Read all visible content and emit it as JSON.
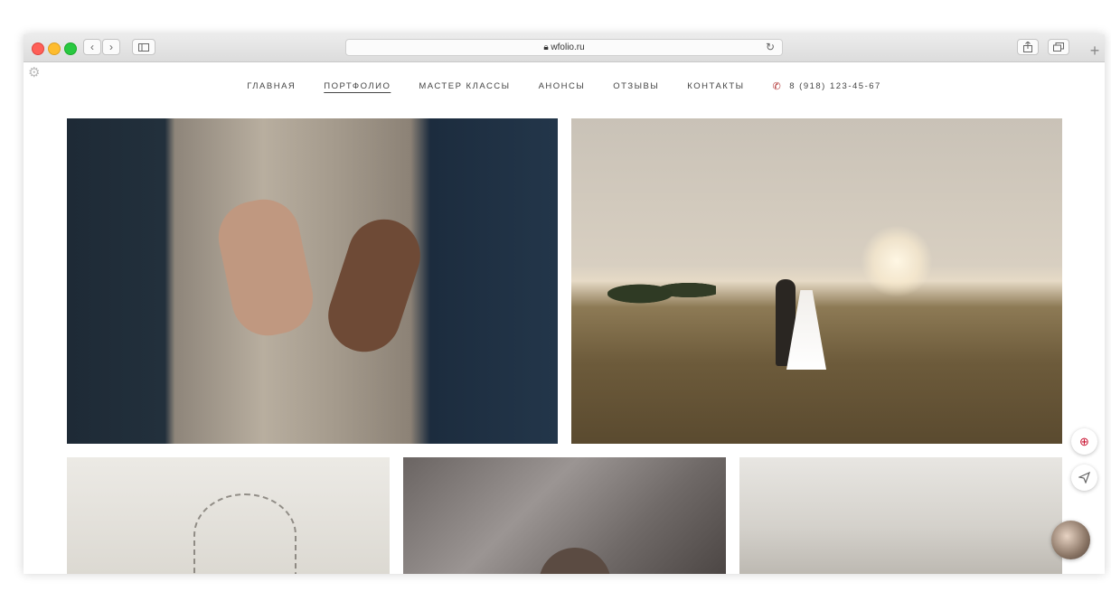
{
  "browser": {
    "url": "wfolio.ru",
    "lock_icon": "lock-icon",
    "back_icon": "chevron-left-icon",
    "forward_icon": "chevron-right-icon",
    "sidebar_icon": "sidebar-icon",
    "reload_icon": "reload-icon",
    "share_icon": "share-icon",
    "tabs_icon": "tabs-icon",
    "new_tab_icon": "plus-icon"
  },
  "nav": {
    "items": [
      {
        "label": "ГЛАВНАЯ",
        "active": false
      },
      {
        "label": "ПОРТФОЛИО",
        "active": true
      },
      {
        "label": "МАСТЕР КЛАССЫ",
        "active": false
      },
      {
        "label": "АНОНСЫ",
        "active": false
      },
      {
        "label": "ОТЗЫВЫ",
        "active": false
      },
      {
        "label": "КОНТАКТЫ",
        "active": false
      }
    ],
    "phone": "8 (918) 123-45-67",
    "phone_icon": "phone-icon"
  },
  "gallery": {
    "photos": [
      {
        "subject": "couple holding hands"
      },
      {
        "subject": "wedding couple in field at sunset"
      },
      {
        "subject": "bare tree"
      },
      {
        "subject": "woman portrait"
      },
      {
        "subject": "white corridor"
      }
    ]
  },
  "floating": {
    "language_icon": "uk-flag-icon",
    "message_icon": "paper-plane-icon",
    "avatar": "avatar"
  },
  "colors": {
    "accent_phone": "#b03030",
    "text": "#444444",
    "background": "#ffffff"
  }
}
